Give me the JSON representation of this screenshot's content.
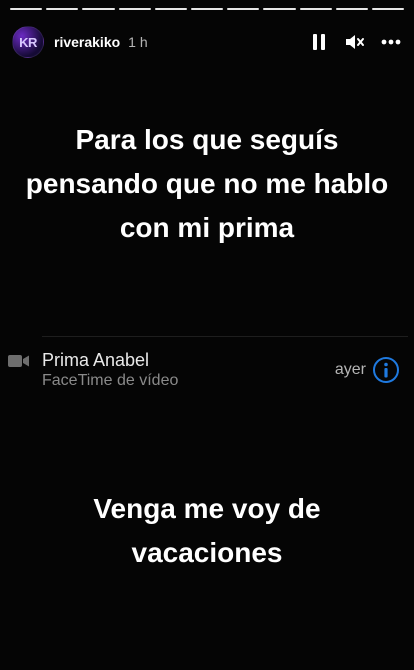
{
  "story": {
    "segment_count": 11,
    "user": {
      "avatar_text": "KR",
      "username": "riverakiko",
      "time": "1 h"
    },
    "controls": {
      "pause_icon": "pause-icon",
      "mute_icon": "muted-speaker-icon",
      "more_icon": "more-dots-icon"
    },
    "text_top": "Para los que seguís pensando que no me hablo con mi prima",
    "call_entry": {
      "name": "Prima Anabel",
      "type": "FaceTime de vídeo",
      "when": "ayer",
      "icon": "video-camera-icon",
      "info_icon": "info-icon"
    },
    "text_bottom": "Venga me voy de vacaciones",
    "colors": {
      "background": "#050505",
      "text": "#ffffff",
      "info_blue": "#1f7ae0",
      "subtext": "#8a8a8a"
    }
  }
}
